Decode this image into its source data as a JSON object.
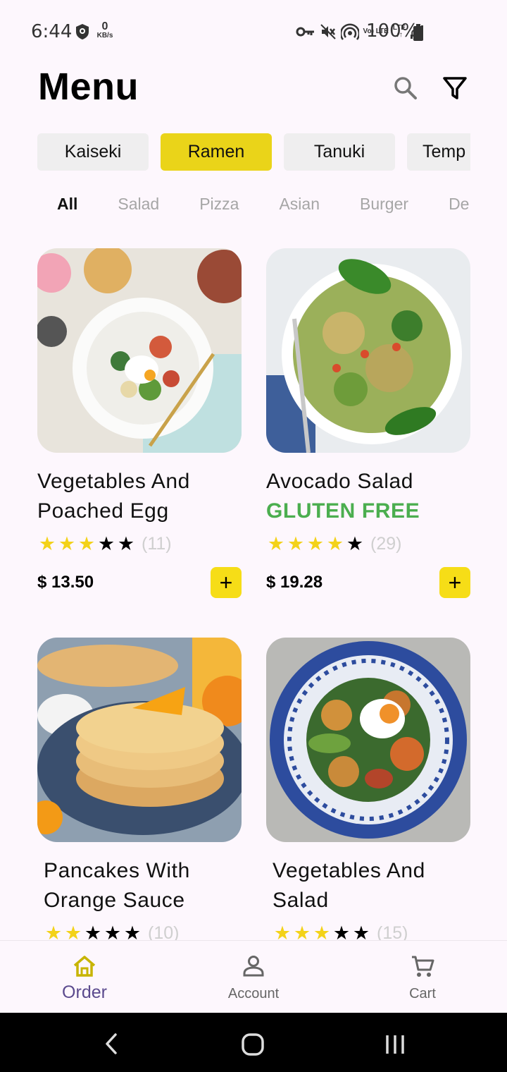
{
  "status_bar": {
    "time": "6:44",
    "net_speed_value": "0",
    "net_speed_unit": "KB/s",
    "net_type_top": "Vo) LTE",
    "net_type_bottom": "LTE",
    "battery": "100%",
    "icons": [
      "shield-icon",
      "key-icon",
      "mute-icon",
      "hotspot-icon",
      "signal-icon",
      "battery-icon"
    ]
  },
  "header": {
    "title": "Menu",
    "search_icon": "search-icon",
    "filter_icon": "filter-icon"
  },
  "categories": [
    {
      "label": "Kaiseki",
      "active": false
    },
    {
      "label": "Ramen",
      "active": true
    },
    {
      "label": "Tanuki",
      "active": false
    },
    {
      "label": "Temp",
      "active": false
    }
  ],
  "sub_tabs": [
    {
      "label": "All",
      "active": true
    },
    {
      "label": "Salad",
      "active": false
    },
    {
      "label": "Pizza",
      "active": false
    },
    {
      "label": "Asian",
      "active": false
    },
    {
      "label": "Burger",
      "active": false
    },
    {
      "label": "De",
      "active": false
    }
  ],
  "products": [
    {
      "name_line1": "Vegetables And",
      "name_line2": "Poached Egg",
      "tag": "",
      "rating": 3,
      "max_rating": 5,
      "reviews": "(11)",
      "price": "$ 13.50",
      "add_label": "+"
    },
    {
      "name_line1": "Avocado Salad",
      "name_line2": "",
      "tag": "GLUTEN FREE",
      "rating": 4,
      "max_rating": 5,
      "reviews": "(29)",
      "price": "$ 19.28",
      "add_label": "+"
    },
    {
      "name_line1": "Pancakes With",
      "name_line2": "Orange Sauce",
      "tag": "",
      "rating": 2,
      "max_rating": 5,
      "reviews": "(10)",
      "price": "",
      "add_label": "+"
    },
    {
      "name_line1": "Vegetables And",
      "name_line2": "Salad",
      "tag": "",
      "rating": 3,
      "max_rating": 5,
      "reviews": "(15)",
      "price": "",
      "add_label": "+"
    }
  ],
  "bottom_nav": [
    {
      "label": "Order",
      "icon": "home-icon",
      "active": true
    },
    {
      "label": "Account",
      "icon": "person-icon",
      "active": false
    },
    {
      "label": "Cart",
      "icon": "cart-icon",
      "active": false
    }
  ],
  "colors": {
    "accent": "#ead419",
    "add_button": "#f6dd17",
    "star": "#f3d219",
    "tag_green": "#4bae4f",
    "nav_active": "#5b4a8e",
    "background": "#fdf7fd"
  },
  "system_nav": [
    "back-icon",
    "home-circle-icon",
    "recents-icon"
  ]
}
